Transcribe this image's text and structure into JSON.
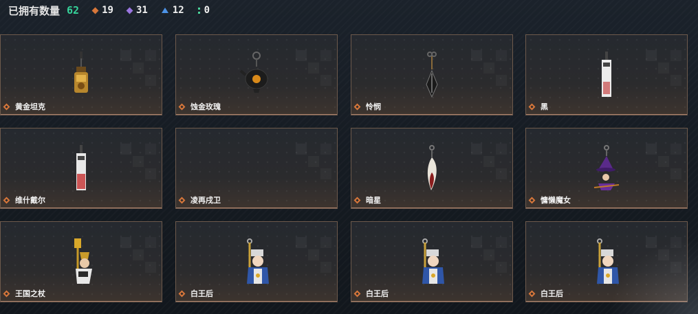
{
  "header": {
    "owned_label": "已拥有数量",
    "owned_count": "62",
    "stats": [
      {
        "icon": "orange-diamond-icon",
        "value": "19",
        "color": "#d8773a"
      },
      {
        "icon": "purple-diamond-icon",
        "value": "31",
        "color": "#9a76e0"
      },
      {
        "icon": "blue-triangle-icon",
        "value": "12",
        "color": "#4d93e6"
      },
      {
        "icon": "green-dots-icon",
        "value": "0",
        "color": "#4bd39a"
      }
    ]
  },
  "items": [
    {
      "name": "黄金坦克",
      "charm": "gold-tank-charm-icon"
    },
    {
      "name": "蚀金玫瑰",
      "charm": "teapot-charm-icon"
    },
    {
      "name": "怜悯",
      "charm": "blade-charm-icon"
    },
    {
      "name": "黑",
      "charm": "tag-charm-icon"
    },
    {
      "name": "维什戴尔",
      "charm": "tag-charm-icon"
    },
    {
      "name": "凌再戌卫",
      "charm": "empty-slot"
    },
    {
      "name": "暗星",
      "charm": "feather-charm-icon"
    },
    {
      "name": "慵懒魔女",
      "charm": "witch-charm-icon"
    },
    {
      "name": "王国之杖",
      "charm": "scepter-king-charm-icon"
    },
    {
      "name": "白王后",
      "charm": "white-queen-charm-icon"
    },
    {
      "name": "白王后",
      "charm": "white-queen-charm-icon"
    },
    {
      "name": "白王后",
      "charm": "white-queen-charm-icon"
    }
  ]
}
